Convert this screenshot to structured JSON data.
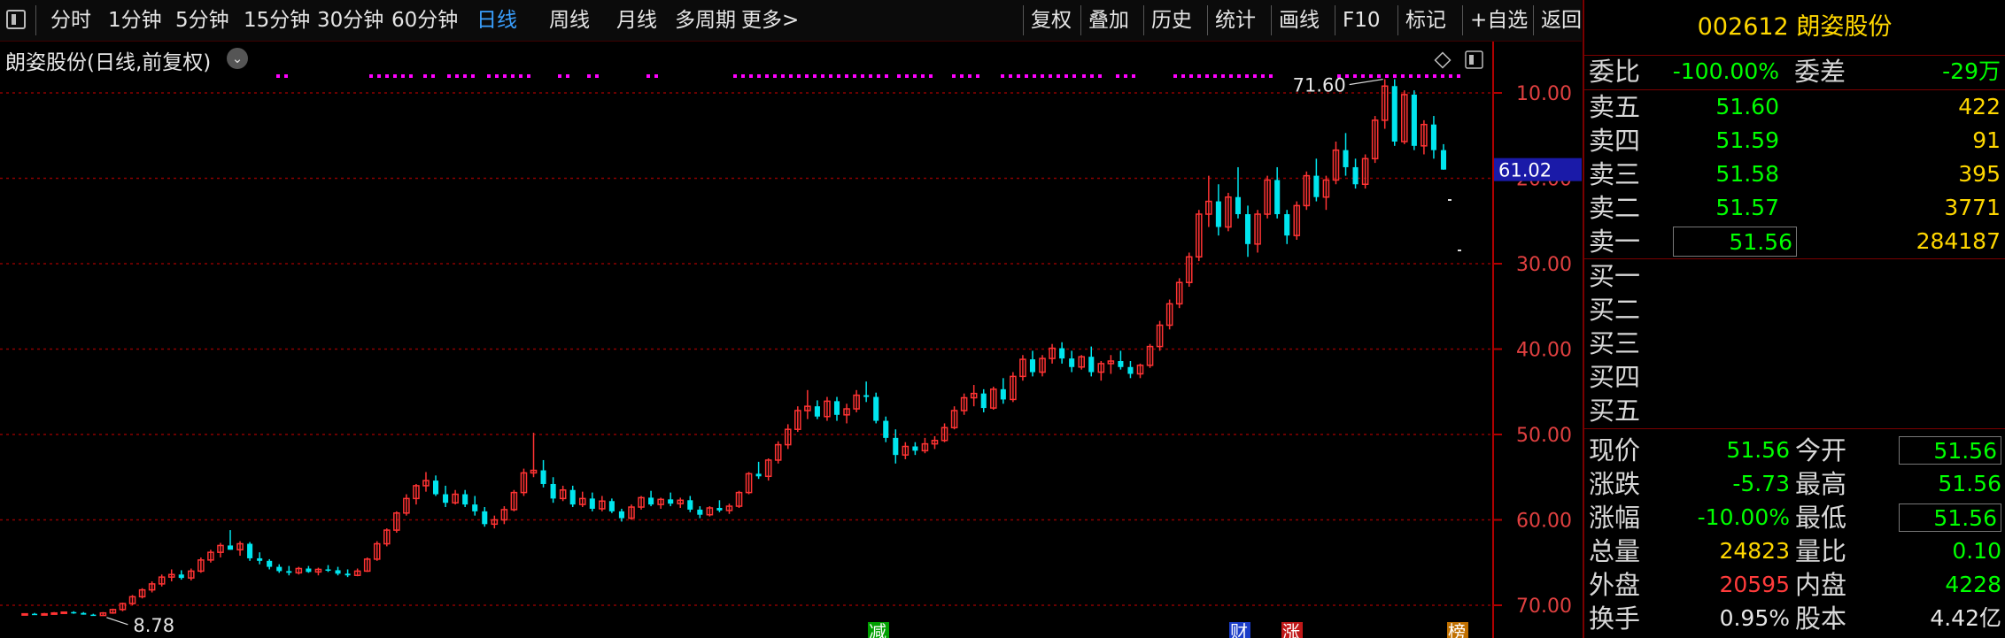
{
  "toolbar": {
    "tabs_left": [
      "分时",
      "1分钟",
      "5分钟",
      "15分钟",
      "30分钟",
      "60分钟",
      "日线",
      "周线",
      "月线",
      "多周期",
      "更多>"
    ],
    "active_tab": "日线",
    "tabs_right": [
      "复权",
      "叠加",
      "历史",
      "统计",
      "画线",
      "F10",
      "标记",
      "+自选",
      "返回"
    ]
  },
  "chart": {
    "title": "朗姿股份(日线,前复权)",
    "current_price_tag": "61.02",
    "high_label": "71.60",
    "low_label": "8.78",
    "y_ticks": [
      "70.00",
      "60.00",
      "50.00",
      "40.00",
      "30.00",
      "20.00",
      "10.00"
    ],
    "event_markers": [
      "减",
      "财",
      "涨",
      "榜"
    ],
    "colors": {
      "up": "#ff3333",
      "down": "#00e5ee",
      "grid": "#8b0000",
      "dots": "#ff00ff",
      "tag_bg": "#1a1aa8"
    }
  },
  "chart_data": {
    "type": "candlestick",
    "ylim": [
      8,
      74
    ],
    "y_ticks": [
      10,
      20,
      30,
      40,
      50,
      60,
      70
    ],
    "candles": [
      [
        8.9,
        9.0,
        8.8,
        9.0
      ],
      [
        9.0,
        9.1,
        8.9,
        8.9
      ],
      [
        8.9,
        9.1,
        8.8,
        9.0
      ],
      [
        9.0,
        9.2,
        8.9,
        9.1
      ],
      [
        9.1,
        9.2,
        9.0,
        9.2
      ],
      [
        9.2,
        9.3,
        9.0,
        9.1
      ],
      [
        9.1,
        9.2,
        8.9,
        8.9
      ],
      [
        8.9,
        9.0,
        8.8,
        8.8
      ],
      [
        8.8,
        9.2,
        8.78,
        9.1
      ],
      [
        9.1,
        9.6,
        9.0,
        9.5
      ],
      [
        9.5,
        10.3,
        9.3,
        10.2
      ],
      [
        10.2,
        11.2,
        10.0,
        11.0
      ],
      [
        11.0,
        12.0,
        10.8,
        11.8
      ],
      [
        11.8,
        12.8,
        11.5,
        12.5
      ],
      [
        12.5,
        13.6,
        12.2,
        13.3
      ],
      [
        13.3,
        14.2,
        12.8,
        13.6
      ],
      [
        13.6,
        14.1,
        13.0,
        13.2
      ],
      [
        13.2,
        14.3,
        12.9,
        14.0
      ],
      [
        14.0,
        15.6,
        13.8,
        15.3
      ],
      [
        15.3,
        16.5,
        15.0,
        16.2
      ],
      [
        16.2,
        17.3,
        15.6,
        17.0
      ],
      [
        17.0,
        18.8,
        16.5,
        16.5
      ],
      [
        16.5,
        17.5,
        15.8,
        17.2
      ],
      [
        17.2,
        17.4,
        15.2,
        15.5
      ],
      [
        15.5,
        16.2,
        14.8,
        15.2
      ],
      [
        15.2,
        15.4,
        14.2,
        14.5
      ],
      [
        14.5,
        14.8,
        13.8,
        14.0
      ],
      [
        14.0,
        14.6,
        13.5,
        13.8
      ],
      [
        13.8,
        14.5,
        13.6,
        14.3
      ],
      [
        14.3,
        14.6,
        13.8,
        13.9
      ],
      [
        13.9,
        14.4,
        13.5,
        14.2
      ],
      [
        14.2,
        14.7,
        13.9,
        14.1
      ],
      [
        14.1,
        14.5,
        13.5,
        13.7
      ],
      [
        13.7,
        14.2,
        13.3,
        13.5
      ],
      [
        13.5,
        14.3,
        13.4,
        14.0
      ],
      [
        14.0,
        15.6,
        13.9,
        15.4
      ],
      [
        15.4,
        17.5,
        15.2,
        17.2
      ],
      [
        17.2,
        19.0,
        16.9,
        18.8
      ],
      [
        18.8,
        21.0,
        18.5,
        20.8
      ],
      [
        20.8,
        23.0,
        20.5,
        22.5
      ],
      [
        22.5,
        24.2,
        21.8,
        24.0
      ],
      [
        24.0,
        25.6,
        23.3,
        24.6
      ],
      [
        24.6,
        25.2,
        22.8,
        23.0
      ],
      [
        23.0,
        24.0,
        21.5,
        22.0
      ],
      [
        22.0,
        23.5,
        21.8,
        23.0
      ],
      [
        23.0,
        23.5,
        21.5,
        21.8
      ],
      [
        21.8,
        22.8,
        20.5,
        21.0
      ],
      [
        21.0,
        21.5,
        19.2,
        19.5
      ],
      [
        19.5,
        20.5,
        19.0,
        20.0
      ],
      [
        20.0,
        21.6,
        19.5,
        21.2
      ],
      [
        21.2,
        23.5,
        21.0,
        23.2
      ],
      [
        23.2,
        26.0,
        22.8,
        25.5
      ],
      [
        25.5,
        30.2,
        25.0,
        25.8
      ],
      [
        25.8,
        27.0,
        23.8,
        24.2
      ],
      [
        24.2,
        25.0,
        22.0,
        22.5
      ],
      [
        22.5,
        24.0,
        22.2,
        23.5
      ],
      [
        23.5,
        24.0,
        21.5,
        21.8
      ],
      [
        21.8,
        23.3,
        21.5,
        22.5
      ],
      [
        22.5,
        23.2,
        21.0,
        21.3
      ],
      [
        21.3,
        22.8,
        21.0,
        22.2
      ],
      [
        22.2,
        22.5,
        20.8,
        21.0
      ],
      [
        21.0,
        21.3,
        19.8,
        20.2
      ],
      [
        20.2,
        21.8,
        20.0,
        21.5
      ],
      [
        21.5,
        22.8,
        21.2,
        22.6
      ],
      [
        22.6,
        23.4,
        21.6,
        21.8
      ],
      [
        21.8,
        22.6,
        21.3,
        22.4
      ],
      [
        22.4,
        23.2,
        21.6,
        21.9
      ],
      [
        21.9,
        22.6,
        21.4,
        22.3
      ],
      [
        22.3,
        22.8,
        20.9,
        21.2
      ],
      [
        21.2,
        21.6,
        20.2,
        20.6
      ],
      [
        20.6,
        21.6,
        20.4,
        21.4
      ],
      [
        21.4,
        22.3,
        20.9,
        21.1
      ],
      [
        21.1,
        21.9,
        20.7,
        21.6
      ],
      [
        21.6,
        23.4,
        21.4,
        23.2
      ],
      [
        23.2,
        25.6,
        23.0,
        25.4
      ],
      [
        25.4,
        26.8,
        24.8,
        25.1
      ],
      [
        25.1,
        27.2,
        24.6,
        27.0
      ],
      [
        27.0,
        29.2,
        26.6,
        28.8
      ],
      [
        28.8,
        31.2,
        28.3,
        30.6
      ],
      [
        30.6,
        33.3,
        30.3,
        32.8
      ],
      [
        32.8,
        35.2,
        31.8,
        33.3
      ],
      [
        33.3,
        34.0,
        31.8,
        32.1
      ],
      [
        32.1,
        34.4,
        31.6,
        33.9
      ],
      [
        33.9,
        34.4,
        31.6,
        32.3
      ],
      [
        32.3,
        33.6,
        31.3,
        33.0
      ],
      [
        33.0,
        35.2,
        32.6,
        34.6
      ],
      [
        34.6,
        36.2,
        33.8,
        34.4
      ],
      [
        34.4,
        34.9,
        31.3,
        31.6
      ],
      [
        31.6,
        32.1,
        29.1,
        29.6
      ],
      [
        29.6,
        30.6,
        26.6,
        27.6
      ],
      [
        27.6,
        29.1,
        27.1,
        28.6
      ],
      [
        28.6,
        29.1,
        27.6,
        28.1
      ],
      [
        28.1,
        29.6,
        27.8,
        28.9
      ],
      [
        28.9,
        29.8,
        28.3,
        29.3
      ],
      [
        29.3,
        31.3,
        29.1,
        30.8
      ],
      [
        30.8,
        33.3,
        30.6,
        32.8
      ],
      [
        32.8,
        34.8,
        32.3,
        34.3
      ],
      [
        34.3,
        35.8,
        33.3,
        34.8
      ],
      [
        34.8,
        35.3,
        32.6,
        33.1
      ],
      [
        33.1,
        35.6,
        32.9,
        35.3
      ],
      [
        35.3,
        36.6,
        33.6,
        34.1
      ],
      [
        34.1,
        37.3,
        33.8,
        36.8
      ],
      [
        36.8,
        39.3,
        36.3,
        38.8
      ],
      [
        38.8,
        39.8,
        36.8,
        37.3
      ],
      [
        37.3,
        39.3,
        36.8,
        38.9
      ],
      [
        38.9,
        40.6,
        38.3,
        40.1
      ],
      [
        40.1,
        40.8,
        38.3,
        38.9
      ],
      [
        38.9,
        39.8,
        37.3,
        37.9
      ],
      [
        37.9,
        39.3,
        37.6,
        39.1
      ],
      [
        39.1,
        40.3,
        36.8,
        37.3
      ],
      [
        37.3,
        38.6,
        36.3,
        38.3
      ],
      [
        38.3,
        39.3,
        37.1,
        38.6
      ],
      [
        38.6,
        39.8,
        37.6,
        37.9
      ],
      [
        37.9,
        38.6,
        36.6,
        37.1
      ],
      [
        37.1,
        38.3,
        36.6,
        38.1
      ],
      [
        38.1,
        40.6,
        37.8,
        40.3
      ],
      [
        40.3,
        43.3,
        39.8,
        42.8
      ],
      [
        42.8,
        45.8,
        42.3,
        45.3
      ],
      [
        45.3,
        48.3,
        44.8,
        47.8
      ],
      [
        47.8,
        51.3,
        47.3,
        50.8
      ],
      [
        50.8,
        56.3,
        50.3,
        55.8
      ],
      [
        55.8,
        60.3,
        54.3,
        57.3
      ],
      [
        57.3,
        59.3,
        53.3,
        54.3
      ],
      [
        54.3,
        58.3,
        53.8,
        57.8
      ],
      [
        57.8,
        61.3,
        55.3,
        55.8
      ],
      [
        55.8,
        56.8,
        50.8,
        52.3
      ],
      [
        52.3,
        56.3,
        51.3,
        55.8
      ],
      [
        55.8,
        60.3,
        55.3,
        59.8
      ],
      [
        59.8,
        61.3,
        55.3,
        55.8
      ],
      [
        55.8,
        56.3,
        52.3,
        53.3
      ],
      [
        53.3,
        57.3,
        52.8,
        56.8
      ],
      [
        56.8,
        60.8,
        56.3,
        60.3
      ],
      [
        60.3,
        62.3,
        57.3,
        57.8
      ],
      [
        57.8,
        60.3,
        56.3,
        59.8
      ],
      [
        59.8,
        64.3,
        59.3,
        63.3
      ],
      [
        63.3,
        65.3,
        60.3,
        61.3
      ],
      [
        61.3,
        62.3,
        58.8,
        59.3
      ],
      [
        59.3,
        62.8,
        58.8,
        62.3
      ],
      [
        62.3,
        67.3,
        61.8,
        66.8
      ],
      [
        66.8,
        71.6,
        65.8,
        70.8
      ],
      [
        70.8,
        71.6,
        63.8,
        64.3
      ],
      [
        64.3,
        70.3,
        64.0,
        69.8
      ],
      [
        69.8,
        70.3,
        63.3,
        63.8
      ],
      [
        63.8,
        66.8,
        62.8,
        66.3
      ],
      [
        66.3,
        67.3,
        62.3,
        63.3
      ],
      [
        63.3,
        64.0,
        61.0,
        61.02
      ]
    ]
  },
  "panel": {
    "code": "002612",
    "name": "朗姿股份",
    "wei_bi_label": "委比",
    "wei_bi_value": "-100.00%",
    "wei_cha_label": "委差",
    "wei_cha_value": "-29万",
    "sell": [
      {
        "label": "卖五",
        "price": "51.60",
        "vol": "422"
      },
      {
        "label": "卖四",
        "price": "51.59",
        "vol": "91"
      },
      {
        "label": "卖三",
        "price": "51.58",
        "vol": "395"
      },
      {
        "label": "卖二",
        "price": "51.57",
        "vol": "3771"
      },
      {
        "label": "卖一",
        "price": "51.56",
        "vol": "284187"
      }
    ],
    "buy": [
      {
        "label": "买一"
      },
      {
        "label": "买二"
      },
      {
        "label": "买三"
      },
      {
        "label": "买四"
      },
      {
        "label": "买五"
      }
    ],
    "stats": [
      {
        "l1": "现价",
        "v1": "51.56",
        "c1": "green",
        "l2": "今开",
        "v2": "51.56",
        "c2": "green",
        "b2": true
      },
      {
        "l1": "涨跌",
        "v1": "-5.73",
        "c1": "green",
        "l2": "最高",
        "v2": "51.56",
        "c2": "green",
        "b2": false
      },
      {
        "l1": "涨幅",
        "v1": "-10.00%",
        "c1": "green",
        "l2": "最低",
        "v2": "51.56",
        "c2": "green",
        "b2": true
      },
      {
        "l1": "总量",
        "v1": "24823",
        "c1": "yellow",
        "l2": "量比",
        "v2": "0.10",
        "c2": "green",
        "b2": false
      },
      {
        "l1": "外盘",
        "v1": "20595",
        "c1": "red",
        "l2": "内盘",
        "v2": "4228",
        "c2": "green",
        "b2": false
      },
      {
        "l1": "换手",
        "v1": "0.95%",
        "c1": "white",
        "l2": "股本",
        "v2": "4.42亿",
        "c2": "white",
        "b2": false
      }
    ]
  }
}
